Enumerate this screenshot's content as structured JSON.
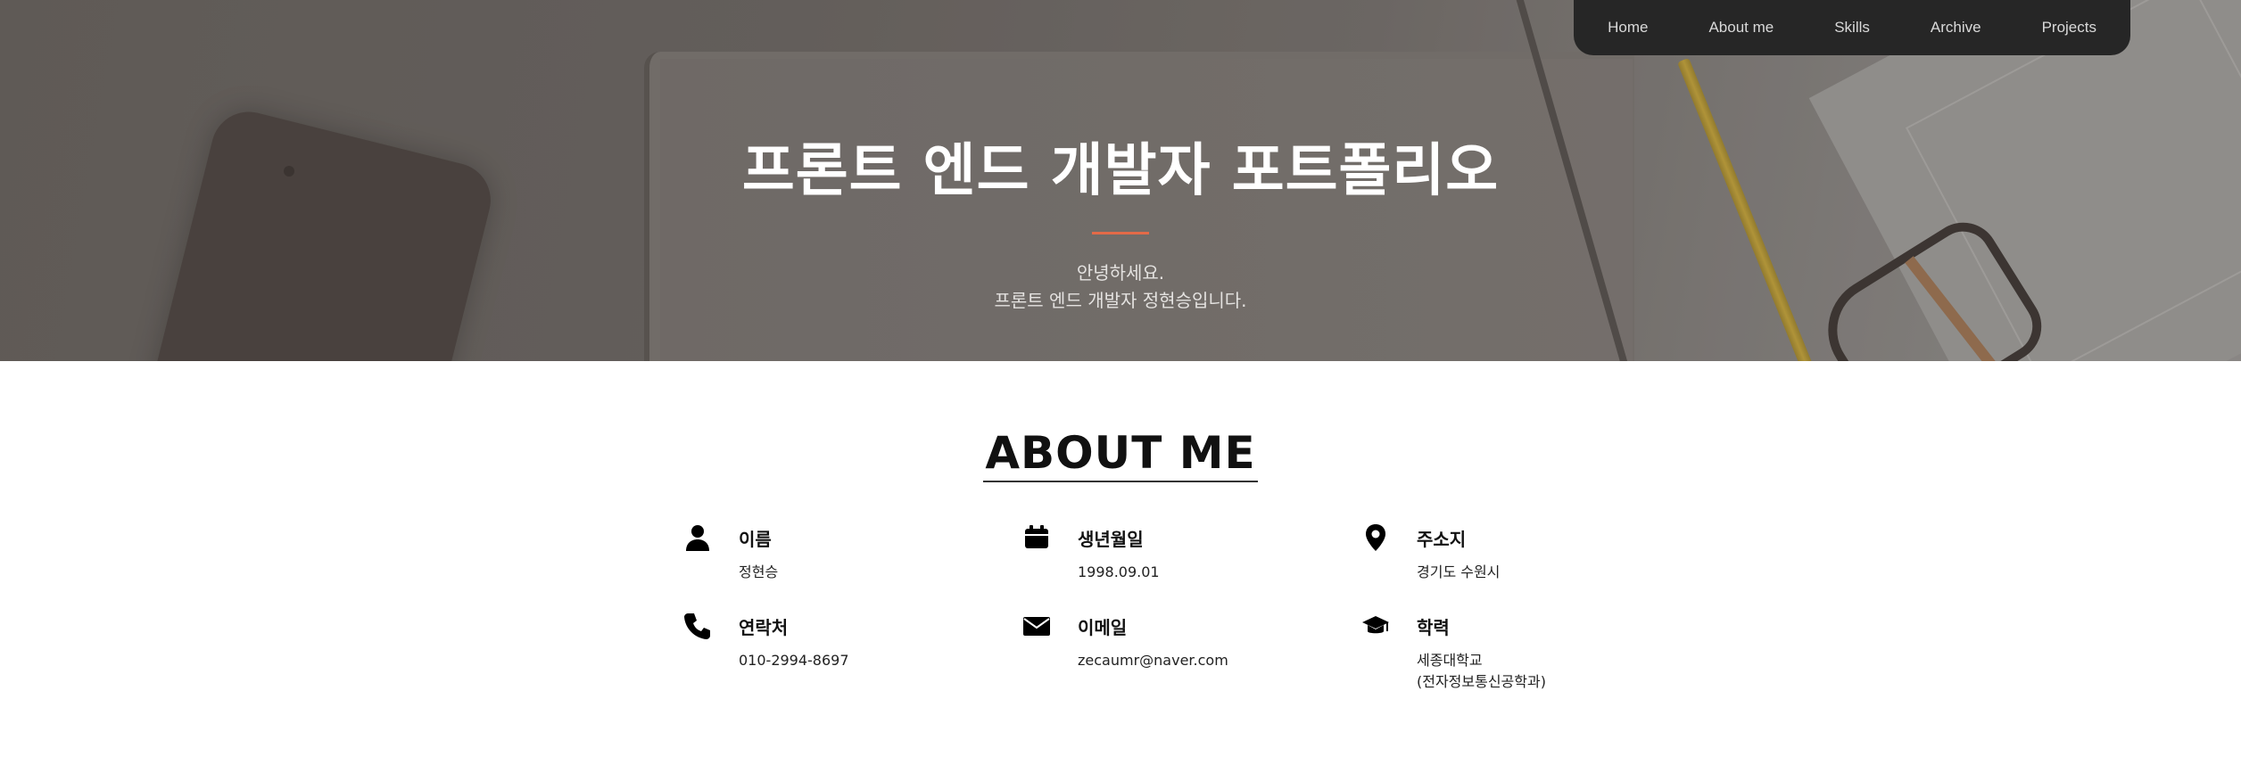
{
  "nav": {
    "items": [
      {
        "label": "Home"
      },
      {
        "label": "About me"
      },
      {
        "label": "Skills"
      },
      {
        "label": "Archive"
      },
      {
        "label": "Projects"
      }
    ]
  },
  "hero": {
    "title": "프론트 엔드 개발자 포트폴리오",
    "subtitle_line1": "안녕하세요.",
    "subtitle_line2": "프론트 엔드 개발자 정현승입니다.",
    "accent_color": "#e36a48"
  },
  "about": {
    "title": "ABOUT ME",
    "items": [
      {
        "icon": "user-icon",
        "label": "이름",
        "value": "정현승"
      },
      {
        "icon": "calendar-icon",
        "label": "생년월일",
        "value": "1998.09.01"
      },
      {
        "icon": "map-marker-icon",
        "label": "주소지",
        "value": "경기도 수원시"
      },
      {
        "icon": "phone-icon",
        "label": "연락처",
        "value": "010-2994-8697"
      },
      {
        "icon": "envelope-icon",
        "label": "이메일",
        "value": "zecaumr@naver.com"
      },
      {
        "icon": "graduation-cap-icon",
        "label": "학력",
        "value": "세종대학교",
        "value2": "(전자정보통신공학과)"
      }
    ]
  }
}
